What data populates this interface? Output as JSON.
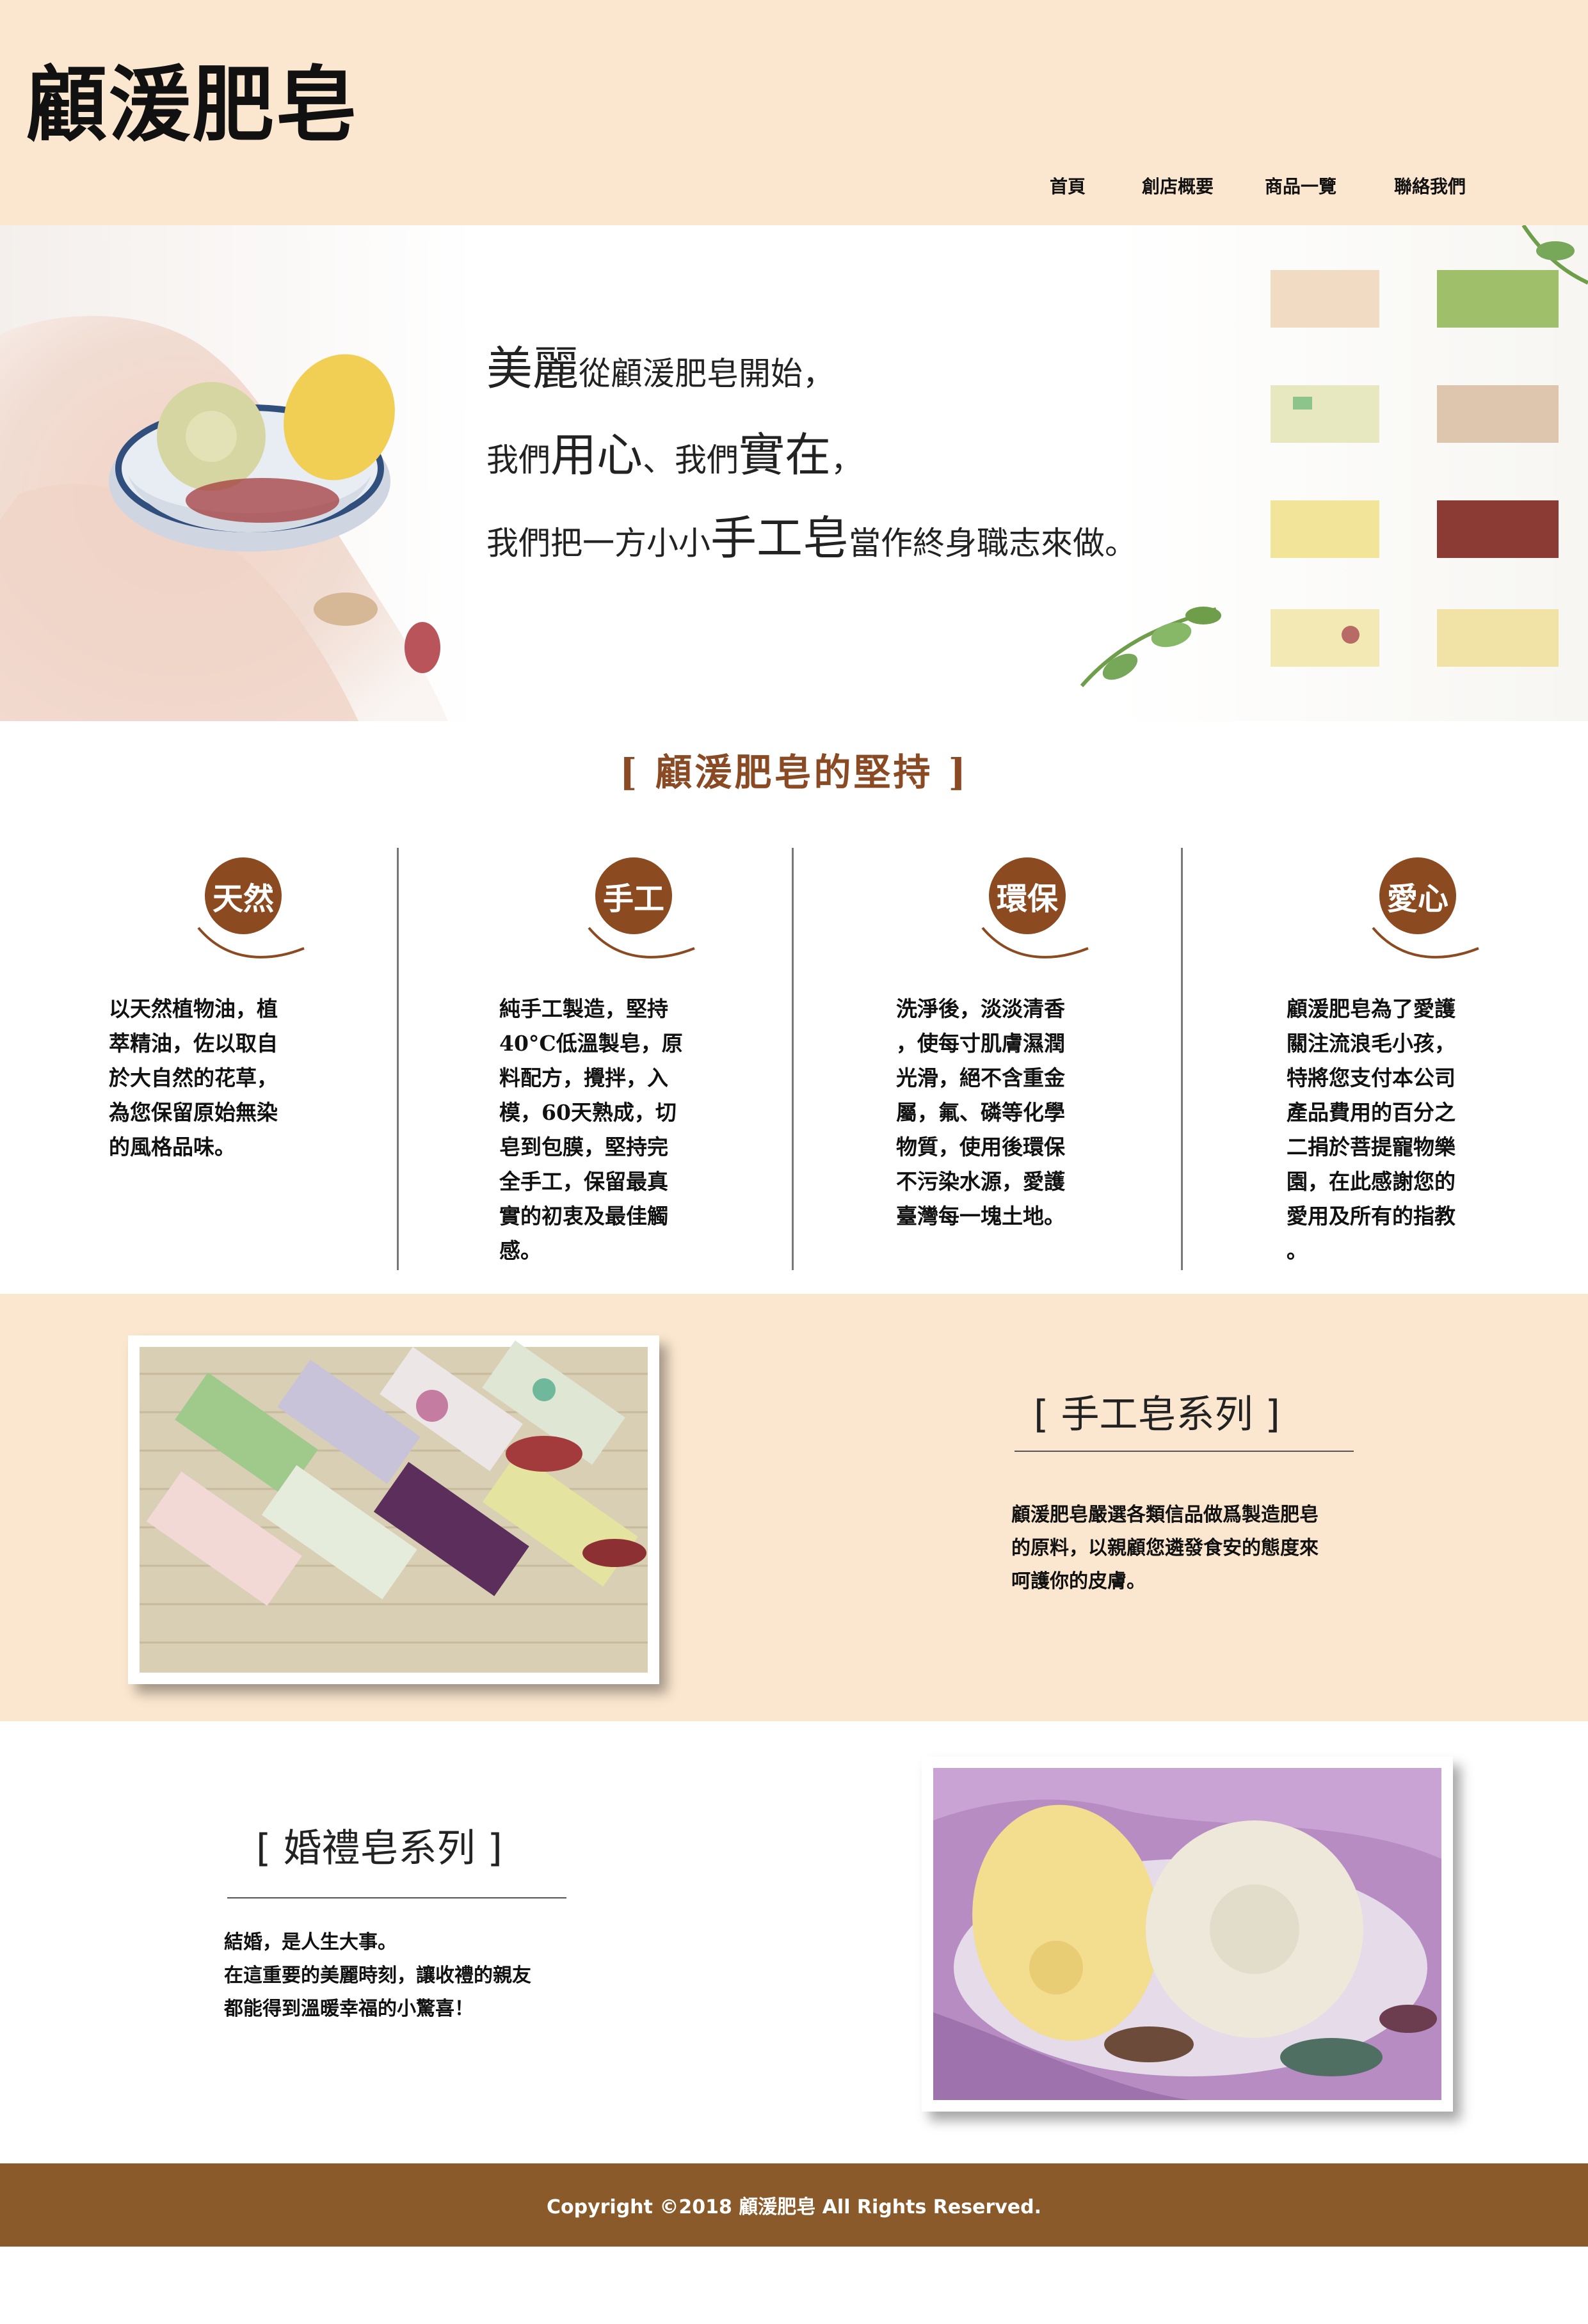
{
  "header": {
    "logo": "顧湲肥皂",
    "nav": [
      "首頁",
      "創店概要",
      "商品一覽",
      "聯絡我們"
    ]
  },
  "hero": {
    "line1_a": "美麗",
    "line1_b": "從顧湲肥皂開始，",
    "line2_a": "我們",
    "line2_b": "用心",
    "line2_c": "、我們",
    "line2_d": "實在",
    "line2_e": "，",
    "line3_a": "我們把一方小小",
    "line3_b": "手工皂",
    "line3_c": "當作終身職志來做。"
  },
  "principles": {
    "title": "[ 顧湲肥皂的堅持 ]",
    "items": [
      {
        "badge": "天然",
        "lines": [
          "以天然植物油，植",
          "萃精油，佐以取自",
          "於大自然的花草，",
          "為您保留原始無染",
          "的風格品味。"
        ]
      },
      {
        "badge": "手工",
        "lines": [
          "純手工製造，堅持",
          "40°C低溫製皂，原",
          "料配方，攪拌，入",
          "模，60天熟成，切",
          "皂到包膜，堅持完",
          "全手工，保留最真",
          "實的初衷及最佳觸",
          "感。"
        ]
      },
      {
        "badge": "環保",
        "lines": [
          "洗淨後，淡淡清香",
          "，使每寸肌膚濕潤",
          "光滑，絕不含重金",
          "屬，氟、磷等化學",
          "物質，使用後環保",
          "不污染水源，愛護",
          "臺灣每一塊土地。"
        ]
      },
      {
        "badge": "愛心",
        "lines": [
          "顧湲肥皂為了愛護",
          "關注流浪毛小孩，",
          "特將您支付本公司",
          "產品費用的百分之",
          "二捐於菩提寵物樂",
          "園，在此感謝您的",
          "愛用及所有的指教",
          "。"
        ]
      }
    ]
  },
  "handmade": {
    "title": "[ 手工皂系列 ]",
    "lines": [
      "顧湲肥皂嚴選各類信品做爲製造肥皂",
      "的原料，以親顧您遴發食安的態度來",
      "呵護你的皮膚。"
    ]
  },
  "wedding": {
    "title": "[ 婚禮皂系列 ]",
    "lines": [
      "結婚，是人生大事。",
      "在這重要的美麗時刻，讓收禮的親友",
      "都能得到溫暖幸福的小驚喜！"
    ]
  },
  "footer": {
    "copyright": "Copyright ©2018 顧湲肥皂 All Rights Reserved."
  },
  "colors": {
    "cream": "#fbe7cf",
    "brown": "#8b4a20",
    "footer": "#8b5a2b"
  }
}
